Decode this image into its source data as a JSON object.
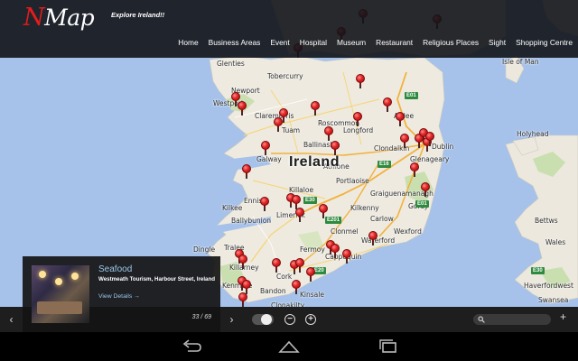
{
  "app": {
    "logo_initial": "N",
    "logo_rest": "Map",
    "tagline": "Explore Ireland!!"
  },
  "nav": {
    "items": [
      "Home",
      "Business Areas",
      "Event",
      "Hospital",
      "Museum",
      "Restaurant",
      "Religious Places",
      "Sight",
      "Shopping Centre"
    ]
  },
  "map": {
    "country_label": "Ireland",
    "places": [
      {
        "name": "Tobercurry"
      },
      {
        "name": "Newport"
      },
      {
        "name": "Westport"
      },
      {
        "name": "Claremorris"
      },
      {
        "name": "Tuam"
      },
      {
        "name": "Ballinasloe"
      },
      {
        "name": "Galway"
      },
      {
        "name": "Killaloe"
      },
      {
        "name": "Limerick"
      },
      {
        "name": "Clondalkin"
      },
      {
        "name": "Dublin"
      },
      {
        "name": "Glenageary"
      },
      {
        "name": "Graiguenamanagh"
      },
      {
        "name": "Clonmel"
      },
      {
        "name": "Waterford"
      },
      {
        "name": "Fermoy"
      },
      {
        "name": "Cork"
      },
      {
        "name": "Kinsale"
      },
      {
        "name": "Tralee"
      },
      {
        "name": "Killarney"
      },
      {
        "name": "Kenmare"
      },
      {
        "name": "Bandon"
      },
      {
        "name": "Dingle"
      },
      {
        "name": "Ballybunion"
      },
      {
        "name": "Glenties"
      },
      {
        "name": "Holyhead"
      },
      {
        "name": "Haverfordwest"
      },
      {
        "name": "Swansea"
      },
      {
        "name": "Isle of Man"
      },
      {
        "name": "Wales"
      },
      {
        "name": "Cappoquin"
      },
      {
        "name": "Bettws"
      },
      {
        "name": "Ennis"
      },
      {
        "name": "Kilkee"
      },
      {
        "name": "Clonakilty"
      },
      {
        "name": "Gorey"
      },
      {
        "name": "Athlone"
      },
      {
        "name": "Roscommon"
      },
      {
        "name": "Longford"
      },
      {
        "name": "Ardee"
      },
      {
        "name": "Portlaoise"
      },
      {
        "name": "Kilkenny"
      },
      {
        "name": "Wexford"
      },
      {
        "name": "Carlow"
      }
    ],
    "roads": [
      {
        "label": "E01"
      },
      {
        "label": "E16"
      },
      {
        "label": "E30"
      },
      {
        "label": "E01"
      },
      {
        "label": "E201"
      },
      {
        "label": "E20"
      },
      {
        "label": "E30"
      }
    ]
  },
  "card": {
    "title": "Seafood",
    "address": "Westmeath Tourism, Harbour Street, Ireland",
    "link": "View Details →",
    "counter": "33 / 69"
  },
  "controls": {
    "prev_icon": "chevron-left-icon",
    "next_icon": "chevron-right-icon",
    "prev_glyph": "‹",
    "next_glyph": "›",
    "zoom_out_glyph": "−",
    "zoom_in_glyph": "+",
    "add_glyph": "+",
    "search_placeholder": ""
  },
  "colors": {
    "sea": "#a6c2ea",
    "land": "#eeeae0",
    "pin": "#e02424",
    "header_bg": "#121418",
    "accent_text": "#9cc7e8"
  }
}
